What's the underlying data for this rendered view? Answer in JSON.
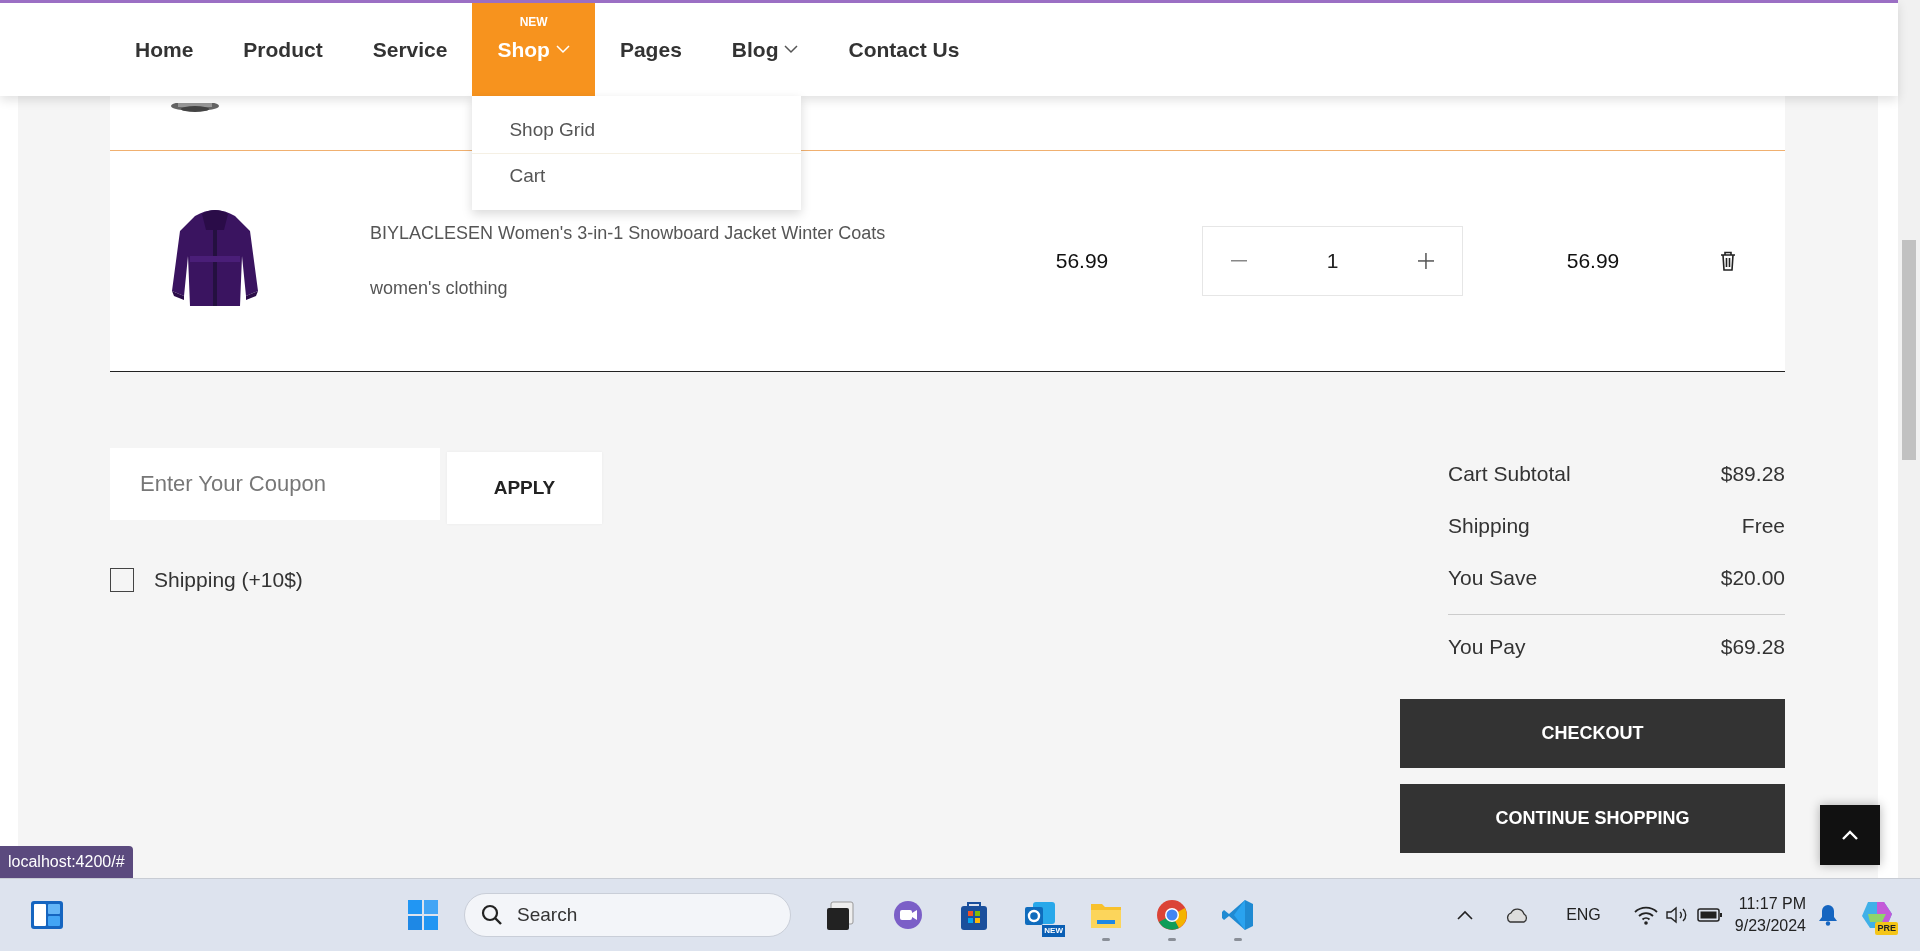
{
  "nav": {
    "items": [
      {
        "label": "Home",
        "selected": false,
        "dropdown": false
      },
      {
        "label": "Product",
        "selected": false,
        "dropdown": false
      },
      {
        "label": "Service",
        "selected": false,
        "dropdown": false
      },
      {
        "label": "Shop",
        "selected": true,
        "dropdown": true,
        "badge": "NEW"
      },
      {
        "label": "Pages",
        "selected": false,
        "dropdown": false
      },
      {
        "label": "Blog",
        "selected": false,
        "dropdown": true
      },
      {
        "label": "Contact Us",
        "selected": false,
        "dropdown": false
      }
    ],
    "open_menu": [
      "Shop Grid",
      "Cart"
    ]
  },
  "cart": {
    "items": [
      {
        "title": "BIYLACLESEN Women's 3-in-1 Snowboard Jacket Winter Coats",
        "category": "women's clothing",
        "price": "56.99",
        "quantity": "1",
        "total": "56.99"
      }
    ]
  },
  "coupon": {
    "placeholder": "Enter Your Coupon",
    "button": "APPLY"
  },
  "shipping_option": {
    "label": "Shipping (+10$)",
    "checked": false
  },
  "totals": [
    {
      "label": "Cart Subtotal",
      "value": "$89.28"
    },
    {
      "label": "Shipping",
      "value": "Free"
    },
    {
      "label": "You Save",
      "value": "$20.00"
    },
    {
      "label": "You Pay",
      "value": "$69.28",
      "kind": "grand"
    }
  ],
  "buttons": [
    "CHECKOUT",
    "CONTINUE SHOPPING"
  ],
  "status_url": "localhost:4200/#",
  "taskbar": {
    "search_placeholder": "Search",
    "apps": [
      {
        "kind": "taskview",
        "running": false
      },
      {
        "kind": "meet",
        "running": false
      },
      {
        "kind": "store",
        "running": false
      },
      {
        "kind": "outlook",
        "running": false,
        "badge": "NEW"
      },
      {
        "kind": "files",
        "running": true
      },
      {
        "kind": "chrome",
        "running": true
      },
      {
        "kind": "code",
        "running": true
      }
    ],
    "language": "ENG",
    "time": "11:17 PM",
    "date": "9/23/2024",
    "copilot_badge": "PRE"
  }
}
